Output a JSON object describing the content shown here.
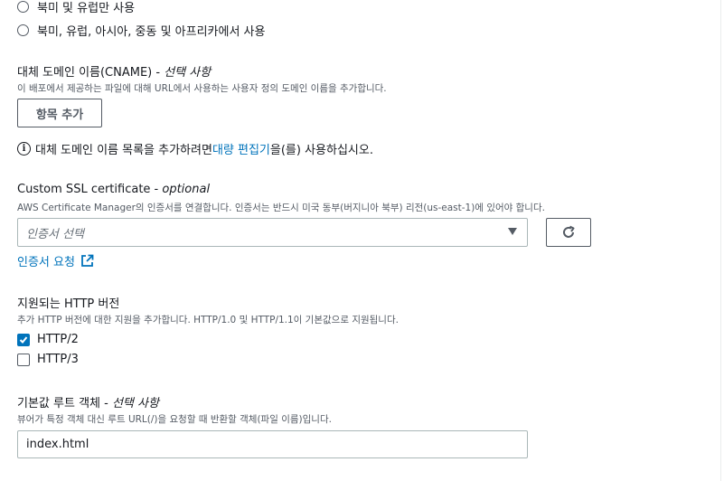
{
  "price_class": {
    "options": [
      "북미 및 유럽만 사용",
      "북미, 유럽, 아시아, 중동 및 아프리카에서 사용"
    ]
  },
  "cname": {
    "label": "대체 도메인 이름(CNAME) - ",
    "label_optional": "선택 사항",
    "description": "이 배포에서 제공하는 파일에 대해 URL에서 사용하는 사용자 정의 도메인 이름을 추가합니다.",
    "add_button": "항목 추가",
    "info_prefix": "대체 도메인 이름 목록을 추가하려면 ",
    "info_link": "대량 편집기",
    "info_suffix": "을(를) 사용하십시오."
  },
  "ssl": {
    "label": "Custom SSL certificate - ",
    "label_optional": "optional",
    "description": "AWS Certificate Manager의 인증서를 연결합니다. 인증서는 반드시 미국 동부(버지니아 북부) 리전(us-east-1)에 있어야 합니다.",
    "select_placeholder": "인증서 선택",
    "request_link": "인증서 요청"
  },
  "http": {
    "label": "지원되는 HTTP 버전",
    "description": "추가 HTTP 버전에 대한 지원을 추가합니다. HTTP/1.0 및 HTTP/1.1이 기본값으로 지원됩니다.",
    "options": [
      {
        "label": "HTTP/2",
        "checked": true
      },
      {
        "label": "HTTP/3",
        "checked": false
      }
    ]
  },
  "root_object": {
    "label": "기본값 루트 객체 - ",
    "label_optional": "선택 사항",
    "description": "뷰어가 특정 객체 대신 루트 URL(/)을 요청할 때 반환할 객체(파일 이름)입니다.",
    "value": "index.html"
  },
  "colors": {
    "link": "#0073bb",
    "checkbox_checked": "#0073bb",
    "text": "#16191f",
    "secondary_text": "#545b64"
  }
}
